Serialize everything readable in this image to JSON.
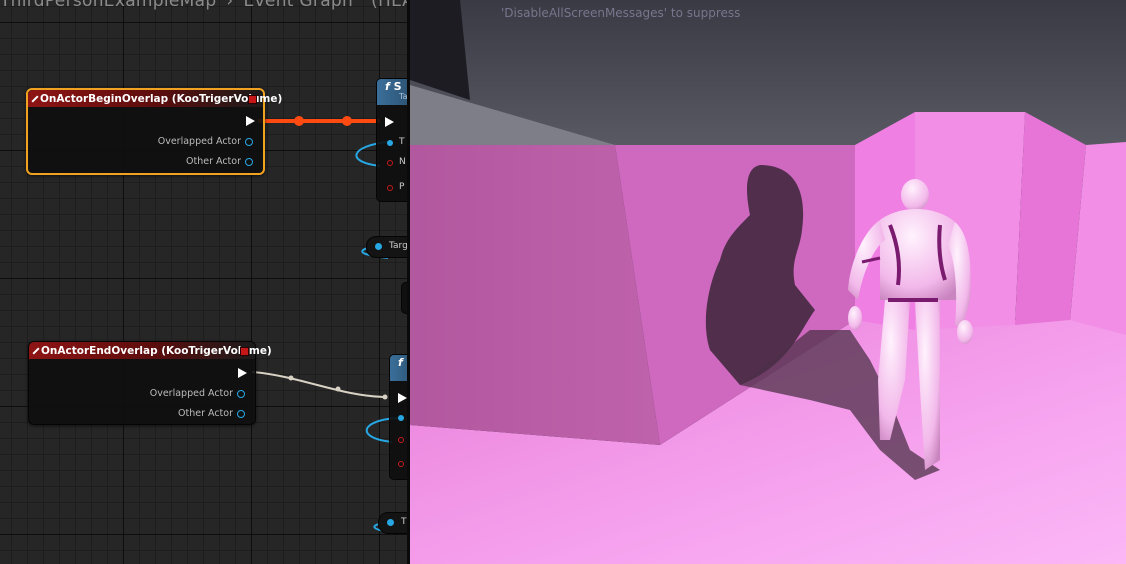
{
  "breadcrumb": {
    "level_name": "ThirdPersonExampleMap",
    "separator": "›",
    "graph_name": "Event Graph",
    "status": "(HEAD"
  },
  "graph": {
    "begin_overlap_node": {
      "title": "OnActorBeginOverlap (KooTrigerVolume)",
      "pins": [
        "Overlapped Actor",
        "Other Actor"
      ]
    },
    "end_overlap_node": {
      "title": "OnActorEndOverlap (KooTrigerVolume)",
      "pins": [
        "Overlapped Actor",
        "Other Actor"
      ]
    },
    "function_node_1": {
      "title": "S",
      "subtitle": "Ta",
      "pins": [
        "T",
        "N",
        "P"
      ]
    },
    "function_node_2": {
      "title": "f"
    },
    "target_var_1": "Targ",
    "target_var_2": "T"
  },
  "viewport": {
    "message": "'DisableAllScreenMessages' to suppress"
  },
  "colors": {
    "exec_wire_active": "#ff4a12",
    "exec_wire": "#d8d2c4",
    "object_pin": "#27a8e5",
    "selection": "#f1a221",
    "event_header": "#8e1414",
    "function_header": "#3a6f9a",
    "wall_pink": "#f082e4",
    "floor_pink": "#f7a2ef"
  }
}
